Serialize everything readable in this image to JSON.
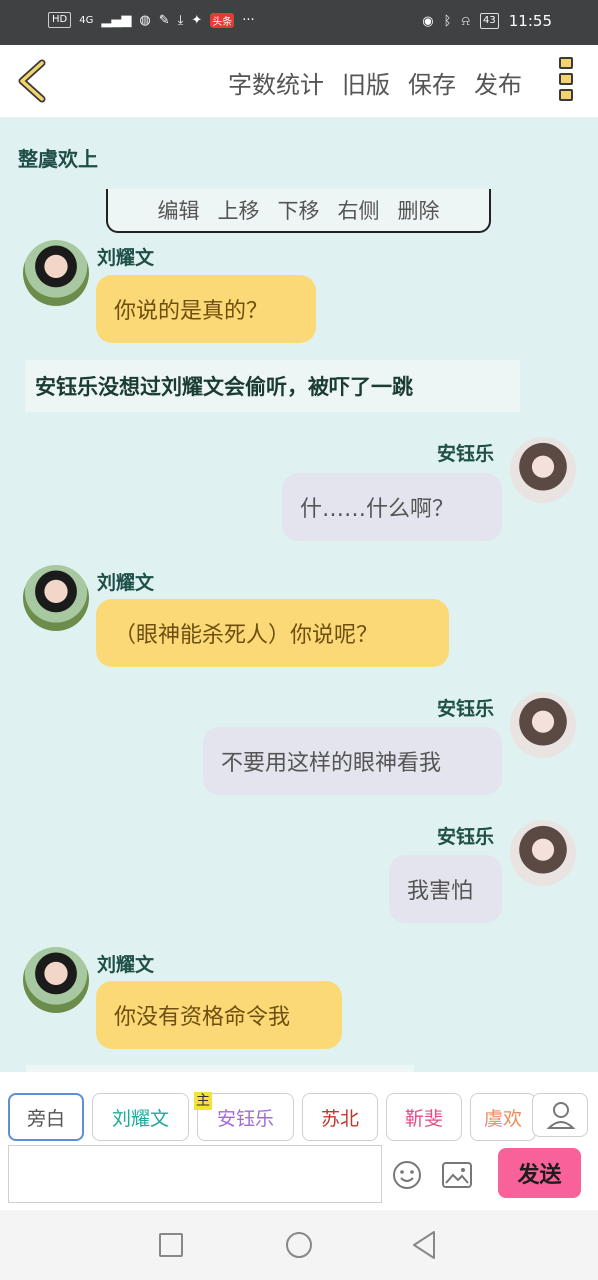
{
  "status_bar": {
    "left_indicators": [
      "HD",
      "4G"
    ],
    "app_badge": "头条",
    "more": "···",
    "battery": "43",
    "time": "11:55"
  },
  "toolbar": {
    "back_icon": "chevron-left-icon",
    "actions": [
      "字数统计",
      "旧版",
      "保存",
      "发布"
    ],
    "more_icon": "more-vertical-icon"
  },
  "scene": {
    "title": "整虞欢上"
  },
  "edit_menu": [
    "编辑",
    "上移",
    "下移",
    "右侧",
    "删除"
  ],
  "messages": [
    {
      "name": "刘耀文",
      "text": "你说的是真的？",
      "side": "left"
    },
    {
      "narration": "安钰乐没想过刘耀文会偷听，被吓了一跳"
    },
    {
      "name": "安钰乐",
      "text": "什……什么啊？",
      "side": "right"
    },
    {
      "name": "刘耀文",
      "text": "（眼神能杀死人）你说呢？",
      "side": "left"
    },
    {
      "name": "安钰乐",
      "text": "不要用这样的眼神看我",
      "side": "right"
    },
    {
      "name": "安钰乐",
      "text": "我害怕",
      "side": "right"
    },
    {
      "name": "刘耀文",
      "text": "你没有资格命令我",
      "side": "left"
    }
  ],
  "roles": [
    {
      "label": "旁白",
      "color": "#555555"
    },
    {
      "label": "刘耀文",
      "color": "#1faaa0"
    },
    {
      "label": "安钰乐",
      "color": "#a36ad8",
      "tag": "主"
    },
    {
      "label": "苏北",
      "color": "#c0392b"
    },
    {
      "label": "靳斐",
      "color": "#e0508a"
    },
    {
      "label": "虞欢",
      "color": "#f08a5d"
    }
  ],
  "composer": {
    "emoji_icon": "emoji-icon",
    "image_icon": "image-icon",
    "send_label": "发送"
  },
  "nav_bar": [
    "recent-apps-icon",
    "home-icon",
    "back-icon"
  ]
}
